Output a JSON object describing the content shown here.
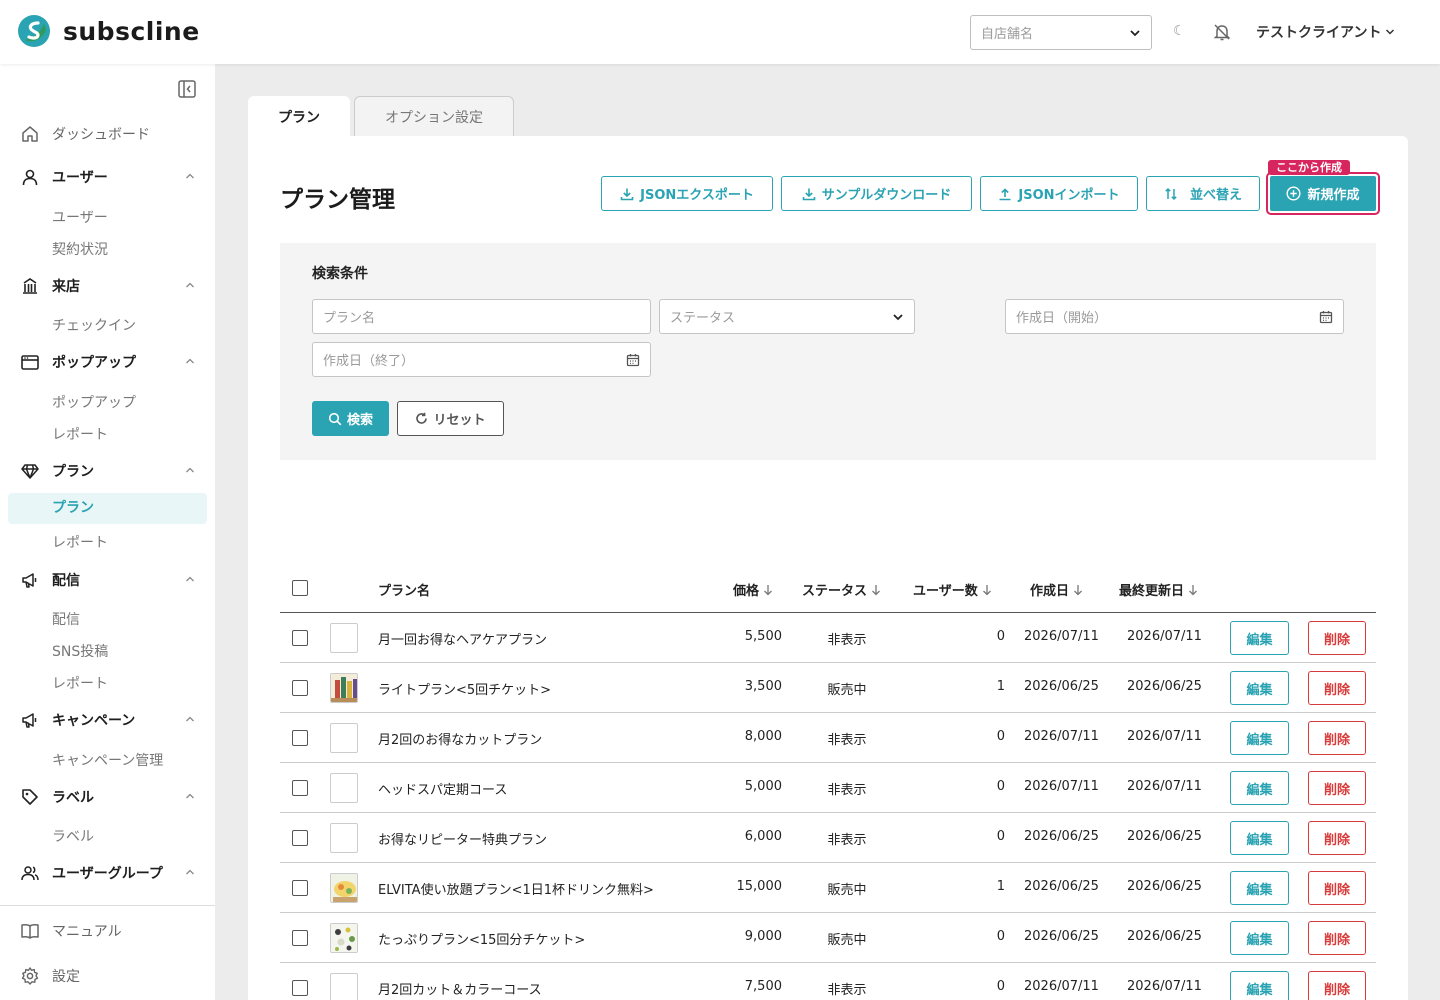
{
  "brand": {
    "name": "subscline",
    "accent": "#2aa3b3",
    "highlight": "#d7265f",
    "danger": "#d93a3a"
  },
  "header": {
    "store_select_placeholder": "自店舗名",
    "theme_icon": "moon-icon",
    "notification_icon": "bell-off-icon",
    "user_name": "テストクライアント"
  },
  "sidebar": {
    "dashboard": "ダッシュボード",
    "users": {
      "label": "ユーザー",
      "children": [
        "ユーザー",
        "契約状況"
      ]
    },
    "visit": {
      "label": "来店",
      "children": [
        "チェックイン"
      ]
    },
    "popup": {
      "label": "ポップアップ",
      "children": [
        "ポップアップ",
        "レポート"
      ]
    },
    "plan": {
      "label": "プラン",
      "children": [
        "プラン",
        "レポート"
      ]
    },
    "delivery": {
      "label": "配信",
      "children": [
        "配信",
        "SNS投稿",
        "レポート"
      ]
    },
    "campaign": {
      "label": "キャンペーン",
      "children": [
        "キャンペーン管理"
      ]
    },
    "label": {
      "label": "ラベル",
      "children": [
        "ラベル"
      ]
    },
    "user_group": {
      "label": "ユーザーグループ"
    },
    "manual": "マニュアル",
    "settings": "設定"
  },
  "tabs": [
    {
      "label": "プラン",
      "active": true
    },
    {
      "label": "オプション設定",
      "active": false
    }
  ],
  "page": {
    "title": "プラン管理",
    "toolbar": {
      "json_export": "JSONエクスポート",
      "sample_download": "サンプルダウンロード",
      "json_import": "JSONインポート",
      "sort": "並べ替え",
      "new": "新規作成",
      "new_hint": "ここから作成"
    }
  },
  "search": {
    "title": "検索条件",
    "plan_name_placeholder": "プラン名",
    "status_placeholder": "ステータス",
    "created_start_placeholder": "作成日（開始）",
    "created_end_placeholder": "作成日（終了）",
    "search_button": "検索",
    "reset_button": "リセット"
  },
  "table": {
    "headers": {
      "name": "プラン名",
      "price": "価格",
      "status": "ステータス",
      "users": "ユーザー数",
      "created": "作成日",
      "updated": "最終更新日"
    },
    "edit_label": "編集",
    "delete_label": "削除",
    "rows": [
      {
        "name": "月一回お得なヘアケアプラン",
        "price": "5,500",
        "status": "非表示",
        "users": "0",
        "created": "2026/07/11",
        "updated": "2026/07/11",
        "thumb": "none"
      },
      {
        "name": "ライトプラン<5回チケット>",
        "price": "3,500",
        "status": "販売中",
        "users": "1",
        "created": "2026/06/25",
        "updated": "2026/06/25",
        "thumb": "bottles"
      },
      {
        "name": "月2回のお得なカットプラン",
        "price": "8,000",
        "status": "非表示",
        "users": "0",
        "created": "2026/07/11",
        "updated": "2026/07/11",
        "thumb": "none"
      },
      {
        "name": "ヘッドスパ定期コース",
        "price": "5,000",
        "status": "非表示",
        "users": "0",
        "created": "2026/07/11",
        "updated": "2026/07/11",
        "thumb": "none"
      },
      {
        "name": "お得なリピーター特典プラン",
        "price": "6,000",
        "status": "非表示",
        "users": "0",
        "created": "2026/06/25",
        "updated": "2026/06/25",
        "thumb": "none"
      },
      {
        "name": "ELVITA使い放題プラン<1日1杯ドリンク無料>",
        "price": "15,000",
        "status": "販売中",
        "users": "1",
        "created": "2026/06/25",
        "updated": "2026/06/25",
        "thumb": "drink"
      },
      {
        "name": "たっぷりプラン<15回分チケット>",
        "price": "9,000",
        "status": "販売中",
        "users": "0",
        "created": "2026/06/25",
        "updated": "2026/06/25",
        "thumb": "dots"
      },
      {
        "name": "月2回カット＆カラーコース",
        "price": "7,500",
        "status": "非表示",
        "users": "0",
        "created": "2026/07/11",
        "updated": "2026/07/11",
        "thumb": "none"
      }
    ]
  }
}
